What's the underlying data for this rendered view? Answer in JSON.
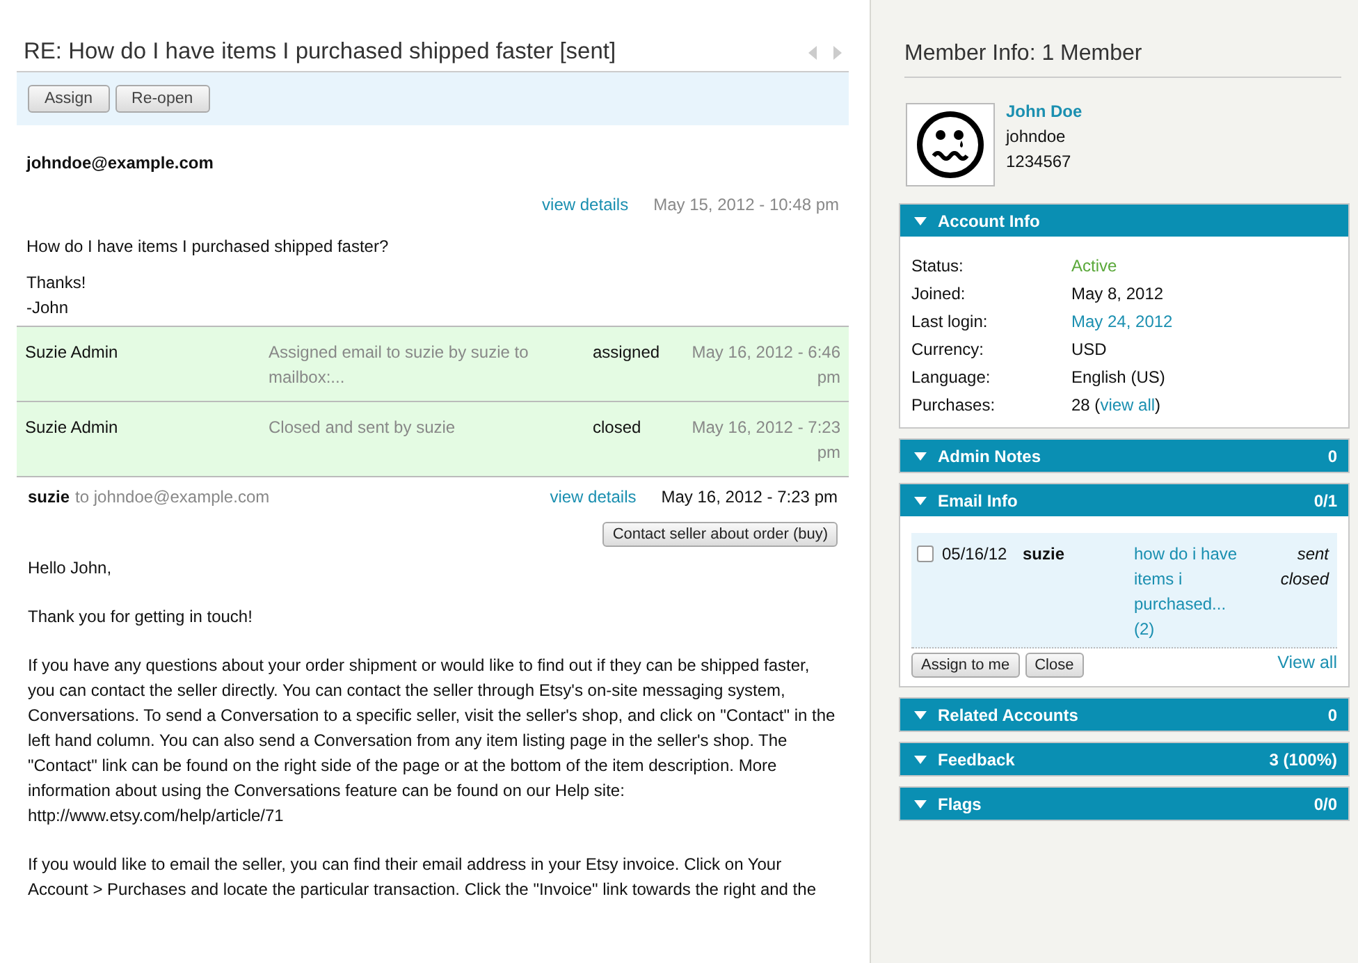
{
  "thread": {
    "title": "RE: How do I have items I purchased shipped faster [sent]",
    "actions": [
      "Assign",
      "Re-open"
    ],
    "messages": [
      {
        "kind": "incoming",
        "sender": "johndoe@example.com",
        "details_link": "view details",
        "time": "May 15, 2012 - 10:48 pm",
        "paragraphs": [
          "How do I have items I purchased shipped faster?",
          "Thanks!\n-John"
        ]
      },
      {
        "kind": "events",
        "events": [
          {
            "actor": "Suzie Admin",
            "description": "Assigned email to suzie by suzie to mailbox:...",
            "status": "assigned",
            "time": "May 16, 2012 - 6:46 pm"
          },
          {
            "actor": "Suzie Admin",
            "description": "Closed and sent by suzie",
            "status": "closed",
            "time": "May 16, 2012 - 7:23 pm"
          }
        ]
      },
      {
        "kind": "outgoing",
        "sender": "suzie",
        "recipient": "to johndoe@example.com",
        "details_link": "view details",
        "time": "May 16, 2012 - 7:23 pm",
        "button": "Contact seller about order (buy)",
        "paragraphs": [
          "Hello John,",
          "Thank you for getting in touch!",
          "If you have any questions about your order shipment or would like to find out if they can be shipped faster, you can contact the seller directly. You can contact the seller through Etsy's on-site messaging system, Conversations. To send a Conversation to a specific seller, visit the seller's shop, and click on \"Contact\" in the left hand column. You can also send a Conversation from any item listing page in the seller's shop. The \"Contact\" link can be found on the right side of the page or at the bottom of the item description. More information about using the Conversations feature can be found on our Help site: http://www.etsy.com/help/article/71",
          "If you would like to email the seller, you can find their email address in your Etsy invoice. Click on Your Account > Purchases and locate the particular transaction. Click the \"Invoice\" link towards the right and the"
        ]
      }
    ]
  },
  "member": {
    "title": "Member Info: 1 Member",
    "name": "John Doe",
    "username": "johndoe",
    "id": "1234567"
  },
  "panels": [
    {
      "kind": "fields",
      "title": "Account Info",
      "fields": [
        {
          "label": "Status:",
          "value": "Active",
          "kind": "active"
        },
        {
          "label": "Joined:",
          "value": "May 8, 2012",
          "kind": "plain"
        },
        {
          "label": "Last login:",
          "value": "May 24, 2012",
          "kind": "link"
        },
        {
          "label": "Currency:",
          "value": "USD",
          "kind": "plain"
        },
        {
          "label": "Language:",
          "value": "English (US)",
          "kind": "plain"
        },
        {
          "label": "Purchases:",
          "value": "28 (",
          "link": "view all",
          "suffix": ")",
          "kind": "mixed"
        }
      ]
    },
    {
      "kind": "collapsed",
      "title": "Admin Notes",
      "count": "0"
    },
    {
      "kind": "emails",
      "title": "Email Info",
      "count": "0/1",
      "emails": [
        {
          "checked": false,
          "date": "05/16/12",
          "sender": "suzie",
          "subject": "how do i have items i purchased... (2)",
          "states": [
            "sent",
            "closed"
          ]
        }
      ],
      "buttons": [
        "Assign to me",
        "Close"
      ],
      "link": "View all"
    },
    {
      "kind": "collapsed",
      "title": "Related Accounts",
      "count": "0"
    },
    {
      "kind": "collapsed",
      "title": "Feedback",
      "count": "3 (100%)"
    },
    {
      "kind": "collapsed",
      "title": "Flags",
      "count": "0/0"
    }
  ]
}
